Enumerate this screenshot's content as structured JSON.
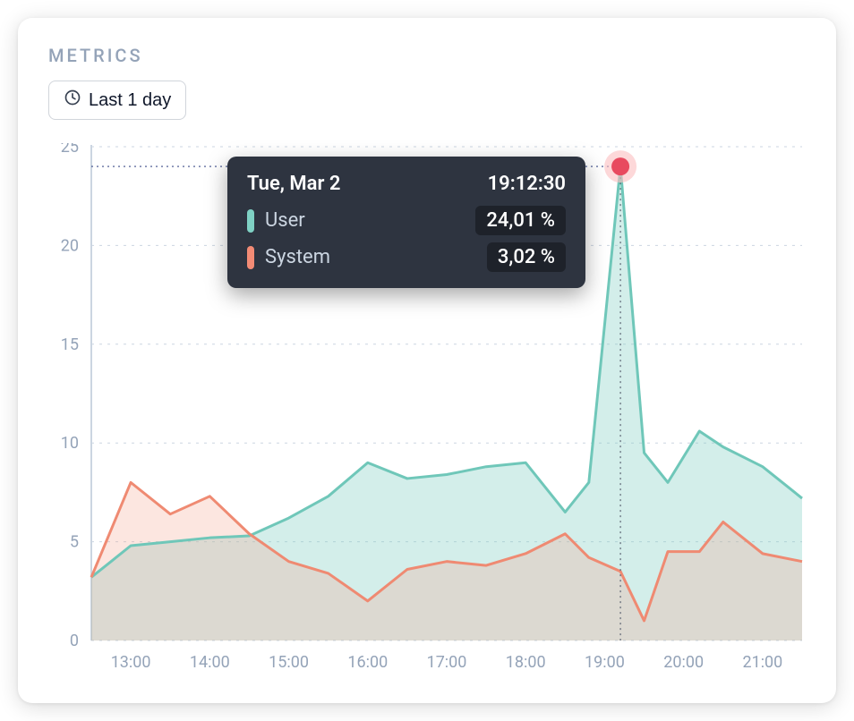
{
  "card": {
    "title": "METRICS",
    "range_label": "Last 1 day"
  },
  "tooltip": {
    "date": "Tue, Mar 2",
    "time": "19:12:30",
    "rows": [
      {
        "label": "User",
        "value": "24,01 %"
      },
      {
        "label": "System",
        "value": "3,02 %"
      }
    ]
  },
  "chart_data": {
    "type": "area",
    "title": "",
    "xlabel": "",
    "ylabel": "",
    "ylim": [
      0,
      25
    ],
    "y_ticks": [
      0,
      5,
      10,
      15,
      20,
      25
    ],
    "x_tick_labels": [
      "13:00",
      "14:00",
      "15:00",
      "16:00",
      "17:00",
      "18:00",
      "19:00",
      "20:00",
      "21:00"
    ],
    "x": [
      12.5,
      13.0,
      13.5,
      14.0,
      14.5,
      15.0,
      15.5,
      16.0,
      16.5,
      17.0,
      17.5,
      18.0,
      18.5,
      18.8,
      19.2,
      19.5,
      19.8,
      20.2,
      20.5,
      21.0,
      21.5
    ],
    "series": [
      {
        "name": "User",
        "color": "#6fc7b9",
        "fill": "rgba(128,206,194,0.35)",
        "values": [
          3.2,
          4.8,
          5.0,
          5.2,
          5.3,
          6.2,
          7.3,
          9.0,
          8.2,
          8.4,
          8.8,
          9.0,
          6.5,
          8.0,
          24.0,
          9.5,
          8.0,
          10.6,
          9.8,
          8.8,
          7.2
        ]
      },
      {
        "name": "System",
        "color": "#ef8a72",
        "fill": "rgba(245,164,143,0.28)",
        "values": [
          3.2,
          8.0,
          6.4,
          7.3,
          5.4,
          4.0,
          3.4,
          2.0,
          3.6,
          4.0,
          3.8,
          4.4,
          5.4,
          4.2,
          3.5,
          1.0,
          4.5,
          4.5,
          6.0,
          4.4,
          4.0
        ]
      }
    ],
    "highlight": {
      "x": 19.2,
      "y": 24.0
    }
  }
}
